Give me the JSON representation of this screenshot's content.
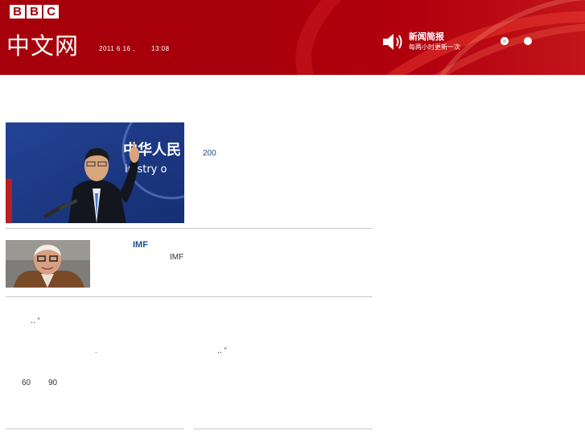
{
  "header": {
    "logo": [
      "B",
      "B",
      "C"
    ],
    "site_title": "中文网",
    "date": "2011 6 16 ,",
    "time": "13:08",
    "news_brief": {
      "title": "新闻简报",
      "subtitle": "每两小时更新一次",
      "icon": "speaker-icon"
    }
  },
  "stories": {
    "top": {
      "text": "200"
    },
    "second": {
      "headline": "IMF",
      "text": "IMF"
    },
    "text_block": {
      "mark_a": "‥  \"",
      "mark_b": ".",
      "mark_c": "‥  \"",
      "num_a": "60",
      "num_b": "90"
    }
  },
  "colors": {
    "header_red": "#a6000a",
    "link_blue": "#1f4e8c",
    "divider_gray": "#c6c6c6"
  }
}
